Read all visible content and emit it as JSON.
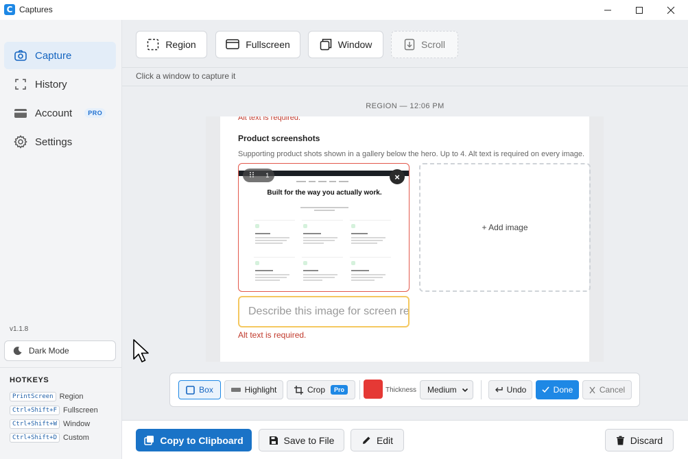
{
  "window": {
    "title": "Captures",
    "logo_letter": "C"
  },
  "sidebar": {
    "items": [
      {
        "label": "Capture",
        "icon": "camera-icon",
        "active": true
      },
      {
        "label": "History",
        "icon": "bracket-frame-icon"
      },
      {
        "label": "Account",
        "icon": "card-icon",
        "badge": "PRO"
      },
      {
        "label": "Settings",
        "icon": "gear-icon"
      }
    ],
    "version": "v1.1.8",
    "dark_mode_label": "Dark Mode",
    "hotkeys_title": "HOTKEYS",
    "hotkeys": [
      {
        "key": "PrintScreen",
        "action": "Region"
      },
      {
        "key": "Ctrl+Shift+F",
        "action": "Fullscreen"
      },
      {
        "key": "Ctrl+Shift+W",
        "action": "Window"
      },
      {
        "key": "Ctrl+Shift+D",
        "action": "Custom"
      }
    ]
  },
  "toolbar": {
    "modes": [
      {
        "label": "Region",
        "icon": "dashed-square-icon"
      },
      {
        "label": "Fullscreen",
        "icon": "monitor-icon"
      },
      {
        "label": "Window",
        "icon": "window-stack-icon"
      },
      {
        "label": "Scroll",
        "icon": "scroll-down-icon",
        "disabled": true
      }
    ],
    "hint": "Click a window to capture it"
  },
  "capture": {
    "label": "REGION — 12:06 PM",
    "cut_error": "Alt text is required.",
    "heading": "Product screenshots",
    "description": "Supporting product shots shown in a gallery below the hero. Up to 4. Alt text is required on every image.",
    "thumb": {
      "index": "1",
      "close": "×",
      "title": "Built for the way you actually work."
    },
    "add_image_label": "+ Add image",
    "alt_placeholder": "Describe this image for screen readers",
    "alt_error": "Alt text is required."
  },
  "annotate": {
    "box": "Box",
    "highlight": "Highlight",
    "crop": "Crop",
    "crop_badge": "Pro",
    "color": "#e53935",
    "thickness_label": "Thickness",
    "thickness_value": "Medium",
    "undo": "Undo",
    "done": "Done",
    "cancel": "Cancel"
  },
  "actions": {
    "copy": "Copy to Clipboard",
    "save": "Save to File",
    "edit": "Edit",
    "discard": "Discard"
  }
}
